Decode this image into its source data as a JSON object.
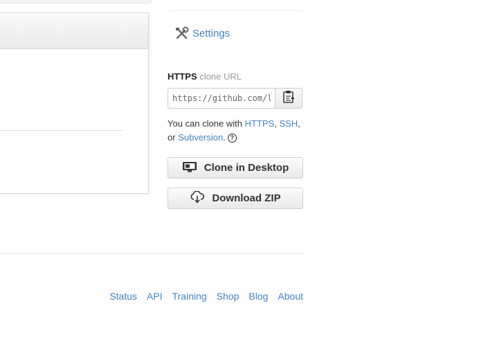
{
  "settings": {
    "label": "Settings",
    "icon": "tools-icon"
  },
  "clone": {
    "protocol": "HTTPS",
    "heading_suffix": "clone URL",
    "url_value": "https://github.com/l",
    "clipboard_icon": "clipboard-icon",
    "help_prefix": "You can clone with",
    "help_https": "HTTPS",
    "help_comma": ",",
    "help_ssh": "SSH",
    "help_or": ", or",
    "help_subversion": "Subversion",
    "help_period": ".",
    "help_icon": "?"
  },
  "buttons": {
    "clone_desktop": "Clone in Desktop",
    "download_zip": "Download ZIP"
  },
  "footer": {
    "links": [
      "Status",
      "API",
      "Training",
      "Shop",
      "Blog",
      "About"
    ]
  },
  "colors": {
    "link": "#4183c4",
    "text": "#333333"
  }
}
